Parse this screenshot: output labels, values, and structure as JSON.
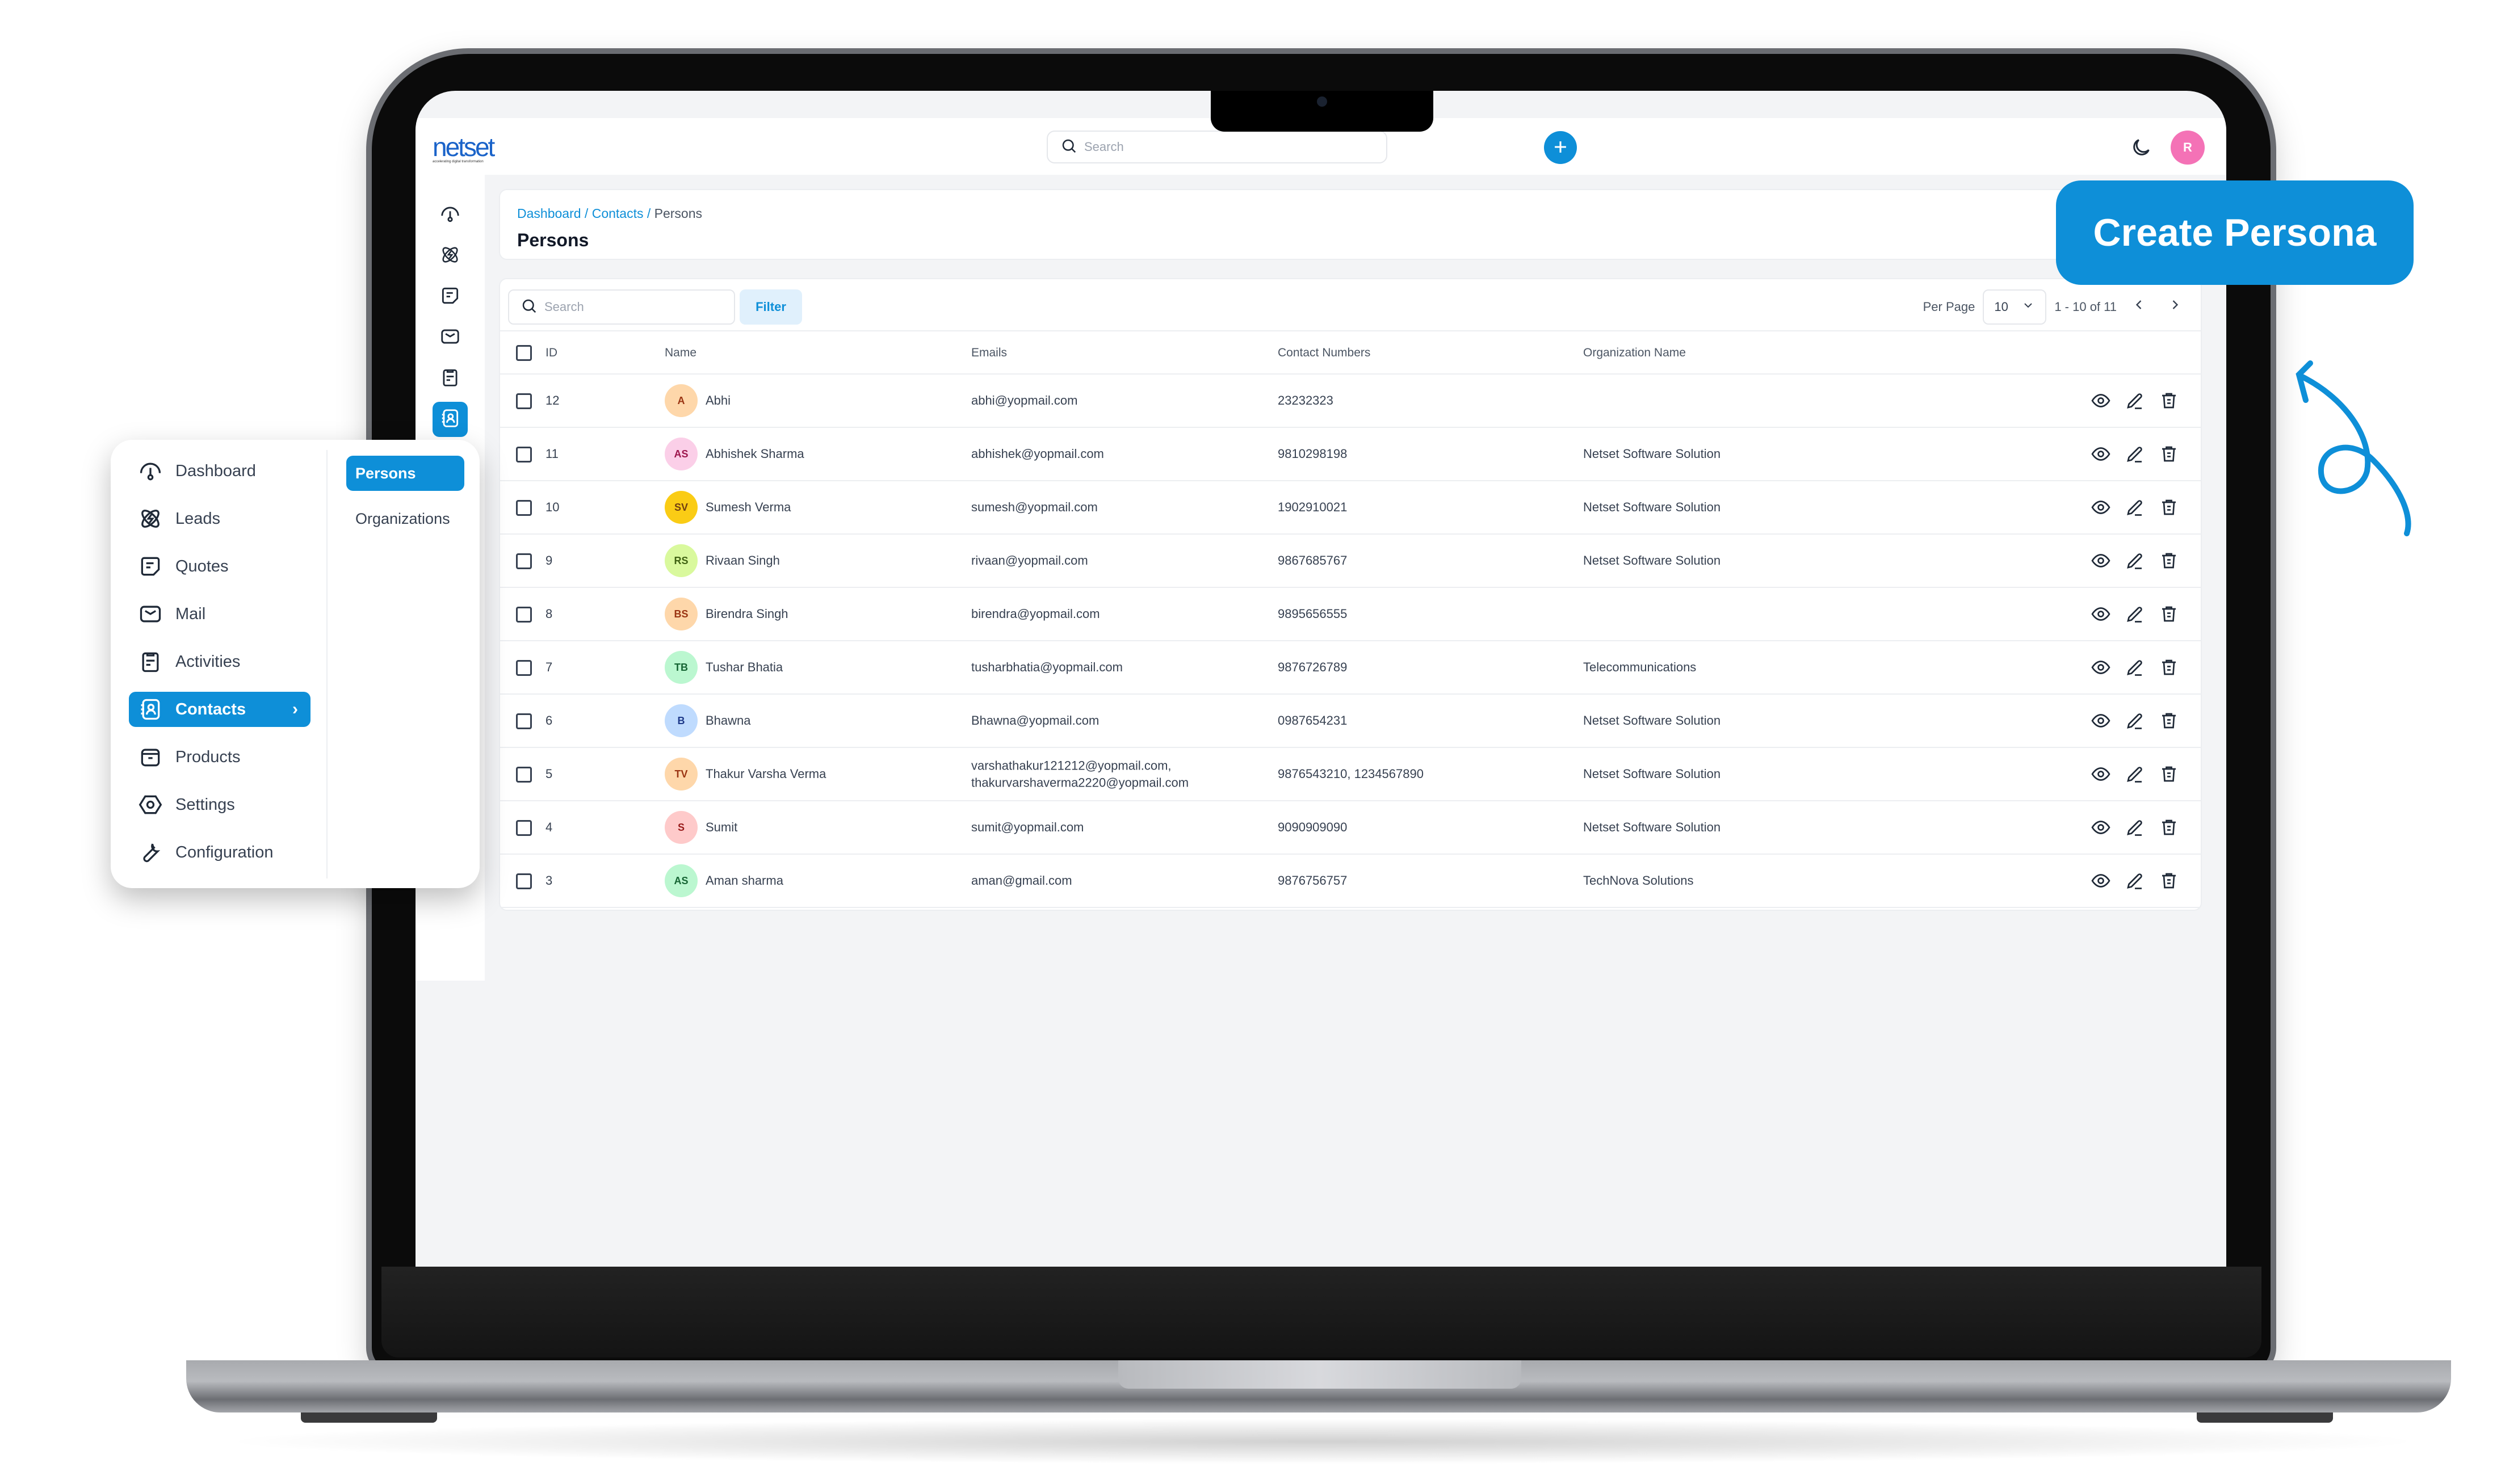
{
  "app": {
    "brand": "netset",
    "brand_tagline": "accelerating digital transformation",
    "accent_color": "#0e8fd8"
  },
  "header": {
    "search_placeholder": "Search",
    "add_button_icon": "plus-icon",
    "theme_toggle_icon": "moon-icon",
    "user_avatar_initial": "R",
    "user_avatar_color": "#f472b6"
  },
  "rail": {
    "items": [
      {
        "name": "dashboard",
        "icon": "gauge-icon",
        "active": false
      },
      {
        "name": "leads",
        "icon": "atom-icon",
        "active": false
      },
      {
        "name": "quotes",
        "icon": "note-icon",
        "active": false
      },
      {
        "name": "mail",
        "icon": "mail-icon",
        "active": false
      },
      {
        "name": "activities",
        "icon": "clipboard-icon",
        "active": false
      },
      {
        "name": "contacts",
        "icon": "contacts-book-icon",
        "active": true
      }
    ]
  },
  "breadcrumb": {
    "items": [
      "Dashboard",
      "Contacts"
    ],
    "separator": " / ",
    "current": "Persons"
  },
  "page": {
    "title": "Persons"
  },
  "toolbar": {
    "search_placeholder": "Search",
    "filter_label": "Filter",
    "per_page_label": "Per Page",
    "per_page_value": "10",
    "range_text": "1 - 10 of 11",
    "prev_icon": "chevron-left-icon",
    "next_icon": "chevron-right-icon"
  },
  "table": {
    "columns": [
      "ID",
      "Name",
      "Emails",
      "Contact Numbers",
      "Organization Name"
    ],
    "rows": [
      {
        "id": "12",
        "initials": "A",
        "avatar_bg": "#fed7aa",
        "avatar_fg": "#9a3412",
        "name": "Abhi",
        "email": "abhi@yopmail.com",
        "email2": "",
        "phone": "23232323",
        "org": ""
      },
      {
        "id": "11",
        "initials": "AS",
        "avatar_bg": "#fbcfe8",
        "avatar_fg": "#9d174d",
        "name": "Abhishek Sharma",
        "email": "abhishek@yopmail.com",
        "email2": "",
        "phone": "9810298198",
        "org": "Netset Software Solution"
      },
      {
        "id": "10",
        "initials": "SV",
        "avatar_bg": "#facc15",
        "avatar_fg": "#713f12",
        "name": "Sumesh Verma",
        "email": "sumesh@yopmail.com",
        "email2": "",
        "phone": "1902910021",
        "org": "Netset Software Solution"
      },
      {
        "id": "9",
        "initials": "RS",
        "avatar_bg": "#d9f99d",
        "avatar_fg": "#3f6212",
        "name": "Rivaan Singh",
        "email": "rivaan@yopmail.com",
        "email2": "",
        "phone": "9867685767",
        "org": "Netset Software Solution"
      },
      {
        "id": "8",
        "initials": "BS",
        "avatar_bg": "#fed7aa",
        "avatar_fg": "#9a3412",
        "name": "Birendra Singh",
        "email": "birendra@yopmail.com",
        "email2": "",
        "phone": "9895656555",
        "org": ""
      },
      {
        "id": "7",
        "initials": "TB",
        "avatar_bg": "#bbf7d0",
        "avatar_fg": "#166534",
        "name": "Tushar Bhatia",
        "email": "tusharbhatia@yopmail.com",
        "email2": "",
        "phone": "9876726789",
        "org": "Telecommunications"
      },
      {
        "id": "6",
        "initials": "B",
        "avatar_bg": "#bfdbfe",
        "avatar_fg": "#1e3a8a",
        "name": "Bhawna",
        "email": "Bhawna@yopmail.com",
        "email2": "",
        "phone": "0987654231",
        "org": "Netset Software Solution"
      },
      {
        "id": "5",
        "initials": "TV",
        "avatar_bg": "#fed7aa",
        "avatar_fg": "#9a3412",
        "name": "Thakur Varsha Verma",
        "email": "varshathakur121212@yopmail.com,",
        "email2": "thakurvarshaverma2220@yopmail.com",
        "phone": "9876543210, 1234567890",
        "org": "Netset Software Solution"
      },
      {
        "id": "4",
        "initials": "S",
        "avatar_bg": "#fecaca",
        "avatar_fg": "#991b1b",
        "name": "Sumit",
        "email": "sumit@yopmail.com",
        "email2": "",
        "phone": "9090909090",
        "org": "Netset Software Solution"
      },
      {
        "id": "3",
        "initials": "AS",
        "avatar_bg": "#bbf7d0",
        "avatar_fg": "#166534",
        "name": "Aman sharma",
        "email": "aman@gmail.com",
        "email2": "",
        "phone": "9876756757",
        "org": "TechNova Solutions"
      }
    ],
    "row_actions": [
      "eye-icon",
      "pencil-icon",
      "trash-icon"
    ]
  },
  "floating_menu": {
    "items": [
      {
        "label": "Dashboard",
        "icon": "gauge-icon",
        "active": false
      },
      {
        "label": "Leads",
        "icon": "atom-icon",
        "active": false
      },
      {
        "label": "Quotes",
        "icon": "note-icon",
        "active": false
      },
      {
        "label": "Mail",
        "icon": "mail-icon",
        "active": false
      },
      {
        "label": "Activities",
        "icon": "clipboard-icon",
        "active": false
      },
      {
        "label": "Contacts",
        "icon": "contacts-book-icon",
        "active": true
      },
      {
        "label": "Products",
        "icon": "box-icon",
        "active": false
      },
      {
        "label": "Settings",
        "icon": "settings-icon",
        "active": false
      },
      {
        "label": "Configuration",
        "icon": "wrench-icon",
        "active": false
      }
    ],
    "submenu": [
      {
        "label": "Persons",
        "active": true
      },
      {
        "label": "Organizations",
        "active": false
      }
    ]
  },
  "callout": {
    "label": "Create Persona"
  }
}
